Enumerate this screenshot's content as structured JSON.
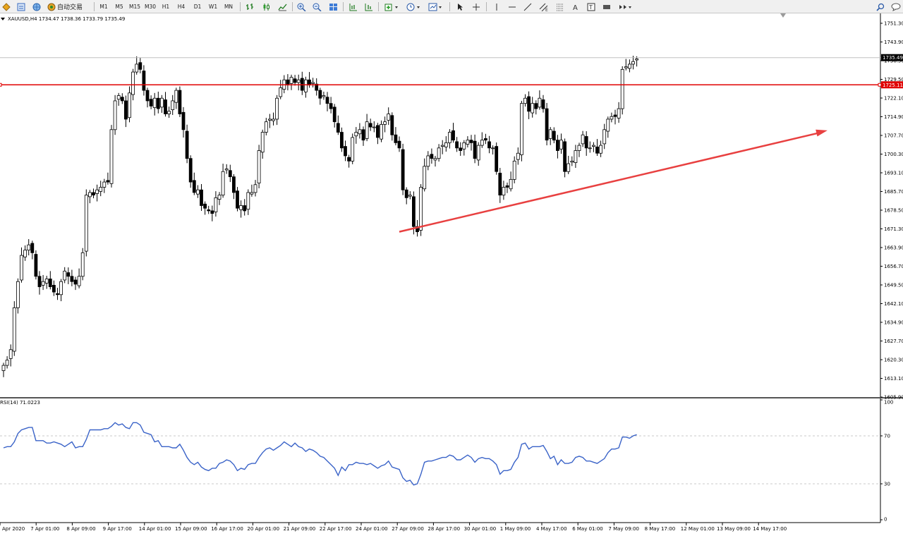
{
  "toolbar": {
    "auto_trading_label": "自动交易",
    "timeframes": [
      "M1",
      "M5",
      "M15",
      "M30",
      "H1",
      "H4",
      "D1",
      "W1",
      "MN"
    ]
  },
  "chart": {
    "symbol_info": "XAUUSD,H4  1734.47 1738.36 1733.79 1735.49",
    "last_price_label": "1735.49",
    "hline_price_label": "1725.11",
    "price_ticks": [
      "1751.30",
      "1743.90",
      "1736.50",
      "1729.50",
      "1722.10",
      "1714.90",
      "1707.70",
      "1700.30",
      "1693.10",
      "1685.70",
      "1678.50",
      "1671.30",
      "1663.90",
      "1656.70",
      "1649.50",
      "1642.10",
      "1634.90",
      "1627.70",
      "1620.30",
      "1613.10",
      "1605.90"
    ],
    "time_labels": [
      "Apr 2020",
      "7 Apr 01:00",
      "8 Apr 09:00",
      "9 Apr 17:00",
      "14 Apr 01:00",
      "15 Apr 09:00",
      "16 Apr 17:00",
      "20 Apr 01:00",
      "21 Apr 09:00",
      "22 Apr 17:00",
      "24 Apr 01:00",
      "27 Apr 09:00",
      "28 Apr 17:00",
      "30 Apr 01:00",
      "1 May 09:00",
      "4 May 17:00",
      "6 May 01:00",
      "7 May 09:00",
      "8 May 17:00",
      "12 May 01:00",
      "13 May 09:00",
      "14 May 17:00"
    ],
    "colors": {
      "bull": "#ffffff",
      "bear": "#000000",
      "hline": "#e00000",
      "arrow": "#e84040",
      "rsi": "#3a63c8",
      "grid": "#c8c8c8"
    }
  },
  "rsi": {
    "label": "RSI(14) 71.0223",
    "ticks": [
      "100",
      "70",
      "30",
      "0"
    ],
    "levels": [
      70,
      30
    ]
  },
  "chart_data": {
    "type": "candlestick",
    "symbol": "XAUUSD",
    "timeframe": "H4",
    "ylim": [
      1605.9,
      1751.3
    ],
    "horizontal_line": 1725.11,
    "last_close": 1735.49,
    "closes": [
      1618,
      1620,
      1624,
      1640,
      1650,
      1660,
      1662,
      1664,
      1661,
      1652,
      1648,
      1650,
      1651,
      1648,
      1646,
      1645,
      1650,
      1654,
      1652,
      1650,
      1649,
      1652,
      1661,
      1683,
      1684,
      1683,
      1685,
      1686,
      1688,
      1688,
      1708,
      1719,
      1721,
      1719,
      1712,
      1722,
      1730,
      1733,
      1731,
      1723,
      1719,
      1717,
      1720,
      1716,
      1720,
      1714,
      1715,
      1719,
      1723,
      1714,
      1708,
      1697,
      1688,
      1684,
      1685,
      1679,
      1678,
      1677,
      1676,
      1682,
      1683,
      1692,
      1693,
      1690,
      1684,
      1678,
      1679,
      1677,
      1684,
      1684,
      1687,
      1700,
      1707,
      1711,
      1712,
      1712,
      1720,
      1724,
      1727,
      1725,
      1728,
      1726,
      1727,
      1723,
      1727,
      1725,
      1726,
      1723,
      1720,
      1721,
      1718,
      1716,
      1711,
      1707,
      1701,
      1698,
      1696,
      1705,
      1707,
      1708,
      1704,
      1711,
      1709,
      1709,
      1705,
      1710,
      1711,
      1714,
      1706,
      1703,
      1701,
      1685,
      1682,
      1683,
      1671,
      1669,
      1686,
      1694,
      1698,
      1697,
      1697,
      1701,
      1702,
      1703,
      1707,
      1704,
      1701,
      1700,
      1703,
      1704,
      1703,
      1697,
      1702,
      1704,
      1704,
      1701,
      1701,
      1692,
      1683,
      1686,
      1686,
      1689,
      1696,
      1699,
      1718,
      1720,
      1715,
      1718,
      1716,
      1720,
      1716,
      1704,
      1708,
      1704,
      1700,
      1704,
      1692,
      1695,
      1696,
      1700,
      1702,
      1706,
      1701,
      1701,
      1702,
      1699,
      1702,
      1708,
      1712,
      1713,
      1713,
      1716,
      1731,
      1732,
      1733,
      1734,
      1735
    ],
    "rsi_period": 14,
    "rsi_last": 71.0223,
    "rsi": [
      60,
      61,
      61,
      65,
      72,
      75,
      76,
      77,
      77,
      66,
      66,
      66,
      64,
      64,
      65,
      64,
      63,
      61,
      63,
      65,
      60,
      61,
      61,
      67,
      75,
      75,
      75,
      75,
      76,
      76,
      78,
      81,
      79,
      80,
      77,
      76,
      81,
      81,
      79,
      73,
      72,
      71,
      65,
      66,
      61,
      61,
      61,
      60,
      60,
      63,
      58,
      52,
      48,
      46,
      48,
      44,
      42,
      41,
      43,
      43,
      47,
      48,
      50,
      49,
      46,
      41,
      43,
      42,
      46,
      47,
      47,
      52,
      56,
      59,
      60,
      58,
      60,
      62,
      65,
      63,
      61,
      64,
      61,
      60,
      57,
      59,
      58,
      56,
      53,
      52,
      49,
      46,
      43,
      37,
      44,
      41,
      46,
      46,
      48,
      47,
      47,
      46,
      47,
      45,
      43,
      45,
      46,
      49,
      44,
      43,
      42,
      35,
      32,
      33,
      29,
      30,
      38,
      48,
      49,
      49,
      50,
      51,
      52,
      52,
      54,
      53,
      50,
      50,
      52,
      54,
      52,
      48,
      51,
      52,
      51,
      51,
      49,
      46,
      38,
      41,
      41,
      42,
      48,
      52,
      63,
      64,
      59,
      61,
      61,
      61,
      62,
      57,
      51,
      53,
      46,
      50,
      47,
      47,
      48,
      52,
      53,
      52,
      49,
      49,
      48,
      47,
      49,
      51,
      56,
      59,
      59,
      60,
      69,
      69,
      68,
      70,
      71
    ]
  }
}
